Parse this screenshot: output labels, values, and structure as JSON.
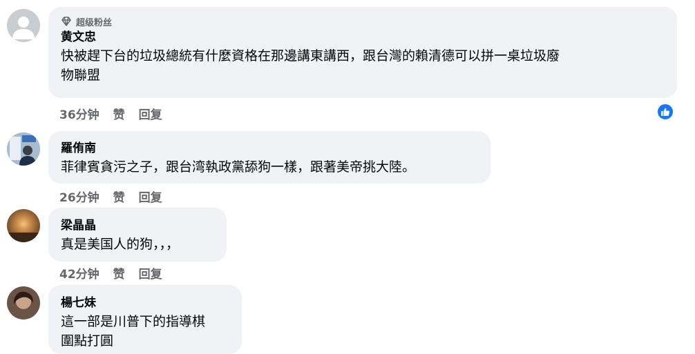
{
  "comments": [
    {
      "badge": "超级粉丝",
      "author": "黄文忠",
      "lines": [
        "快被趕下台的垃圾總統有什麼資格在那邊講東講西，跟台灣的賴清德可以拼一桌垃圾廢",
        "物聯盟"
      ],
      "time": "36分钟",
      "like": "赞",
      "reply": "回复",
      "reaction": "like-icon"
    },
    {
      "author": "羅侑南",
      "lines": [
        "菲律賓貪污之子，跟台湾執政黨舔狗一樣，跟著美帝挑大陸。"
      ],
      "time": "26分钟",
      "like": "赞",
      "reply": "回复"
    },
    {
      "author": "梁晶晶",
      "lines": [
        "真是美国人的狗，，，"
      ],
      "time": "42分钟",
      "like": "赞",
      "reply": "回复"
    },
    {
      "author": "楊七妹",
      "lines": [
        "這一部是川普下的指導棋",
        "圍點打圓"
      ]
    }
  ],
  "colors": {
    "bubble": "#f0f2f5",
    "secondary_text": "#65676b",
    "like_blue": "#1877f2"
  }
}
